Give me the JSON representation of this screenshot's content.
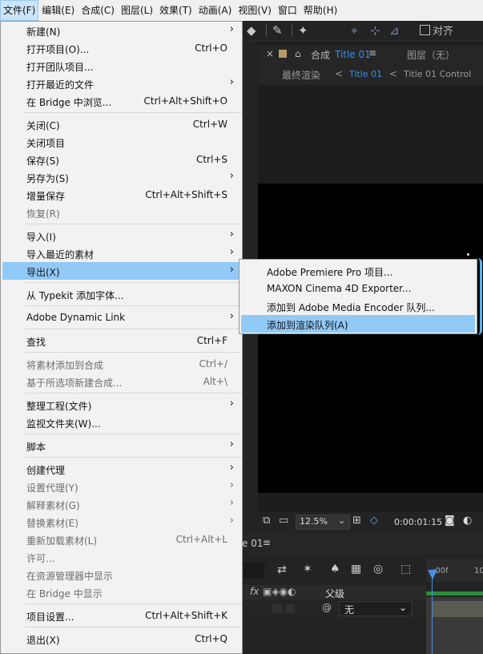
{
  "menubar": [
    "文件(F)",
    "编辑(E)",
    "合成(C)",
    "图层(L)",
    "效果(T)",
    "动画(A)",
    "视图(V)",
    "窗口",
    "帮助(H)"
  ],
  "toolbar": {
    "snap_label": "对齐"
  },
  "comp_panel": {
    "tab_prefix": "合成",
    "comp_name": "Title 01",
    "menu_glyph": "≡",
    "layer_tab": "图层（无）",
    "nav_final": "最终渲染",
    "nav_chevron": "<",
    "nav_title": "Title 01",
    "nav_control": "Title 01 Control",
    "zoom": "12.5%",
    "timecode": "0:00:01:15"
  },
  "timeline": {
    "tab_name": "e 01",
    "menu_glyph": "≡",
    "ruler_start": ":00f",
    "ruler_next": "10",
    "col_switches": "fx",
    "col_parent": "父级",
    "parent_value": "无"
  },
  "file_menu": {
    "items": [
      {
        "label": "新建(N)",
        "shortcut": "",
        "submenu": true,
        "disabled": false
      },
      {
        "label": "打开项目(O)...",
        "shortcut": "Ctrl+O",
        "submenu": false,
        "disabled": false
      },
      {
        "label": "打开团队项目...",
        "shortcut": "",
        "submenu": false,
        "disabled": false
      },
      {
        "label": "打开最近的文件",
        "shortcut": "",
        "submenu": true,
        "disabled": false
      },
      {
        "label": "在 Bridge 中浏览...",
        "shortcut": "Ctrl+Alt+Shift+O",
        "submenu": false,
        "disabled": false
      },
      {
        "label": "关闭(C)",
        "shortcut": "Ctrl+W",
        "submenu": false,
        "disabled": false
      },
      {
        "label": "关闭项目",
        "shortcut": "",
        "submenu": false,
        "disabled": false
      },
      {
        "label": "保存(S)",
        "shortcut": "Ctrl+S",
        "submenu": false,
        "disabled": false
      },
      {
        "label": "另存为(S)",
        "shortcut": "",
        "submenu": true,
        "disabled": false
      },
      {
        "label": "增量保存",
        "shortcut": "Ctrl+Alt+Shift+S",
        "submenu": false,
        "disabled": false
      },
      {
        "label": "恢复(R)",
        "shortcut": "",
        "submenu": false,
        "disabled": true
      },
      {
        "label": "导入(I)",
        "shortcut": "",
        "submenu": true,
        "disabled": false
      },
      {
        "label": "导入最近的素材",
        "shortcut": "",
        "submenu": true,
        "disabled": false
      },
      {
        "label": "导出(X)",
        "shortcut": "",
        "submenu": true,
        "disabled": false,
        "highlighted": true
      },
      {
        "label": "从 Typekit 添加字体...",
        "shortcut": "",
        "submenu": false,
        "disabled": false
      },
      {
        "label": "Adobe Dynamic Link",
        "shortcut": "",
        "submenu": true,
        "disabled": false
      },
      {
        "label": "查找",
        "shortcut": "Ctrl+F",
        "submenu": false,
        "disabled": false
      },
      {
        "label": "将素材添加到合成",
        "shortcut": "Ctrl+/",
        "submenu": false,
        "disabled": true
      },
      {
        "label": "基于所选项新建合成...",
        "shortcut": "Alt+\\",
        "submenu": false,
        "disabled": true
      },
      {
        "label": "整理工程(文件)",
        "shortcut": "",
        "submenu": true,
        "disabled": false
      },
      {
        "label": "监视文件夹(W)...",
        "shortcut": "",
        "submenu": false,
        "disabled": false
      },
      {
        "label": "脚本",
        "shortcut": "",
        "submenu": true,
        "disabled": false
      },
      {
        "label": "创建代理",
        "shortcut": "",
        "submenu": true,
        "disabled": false
      },
      {
        "label": "设置代理(Y)",
        "shortcut": "",
        "submenu": true,
        "disabled": true
      },
      {
        "label": "解释素材(G)",
        "shortcut": "",
        "submenu": true,
        "disabled": true
      },
      {
        "label": "替换素材(E)",
        "shortcut": "",
        "submenu": true,
        "disabled": true
      },
      {
        "label": "重新加载素材(L)",
        "shortcut": "Ctrl+Alt+L",
        "submenu": false,
        "disabled": true
      },
      {
        "label": "许可...",
        "shortcut": "",
        "submenu": false,
        "disabled": true
      },
      {
        "label": "在资源管理器中显示",
        "shortcut": "",
        "submenu": false,
        "disabled": true
      },
      {
        "label": "在 Bridge 中显示",
        "shortcut": "",
        "submenu": false,
        "disabled": true
      },
      {
        "label": "项目设置...",
        "shortcut": "Ctrl+Alt+Shift+K",
        "submenu": false,
        "disabled": false
      },
      {
        "label": "退出(X)",
        "shortcut": "Ctrl+Q",
        "submenu": false,
        "disabled": false
      }
    ]
  },
  "export_menu": {
    "items": [
      {
        "label": "Adobe Premiere Pro 项目..."
      },
      {
        "label": "MAXON Cinema 4D Exporter..."
      },
      {
        "label": "添加到 Adobe Media Encoder 队列..."
      },
      {
        "label": "添加到渲染队列(A)",
        "highlighted": true
      }
    ]
  },
  "colors": {
    "menu_bg": "#f2f2f2",
    "highlight": "#91c9f7",
    "accent_blue": "#4c8de2",
    "app_bg": "#232323"
  }
}
